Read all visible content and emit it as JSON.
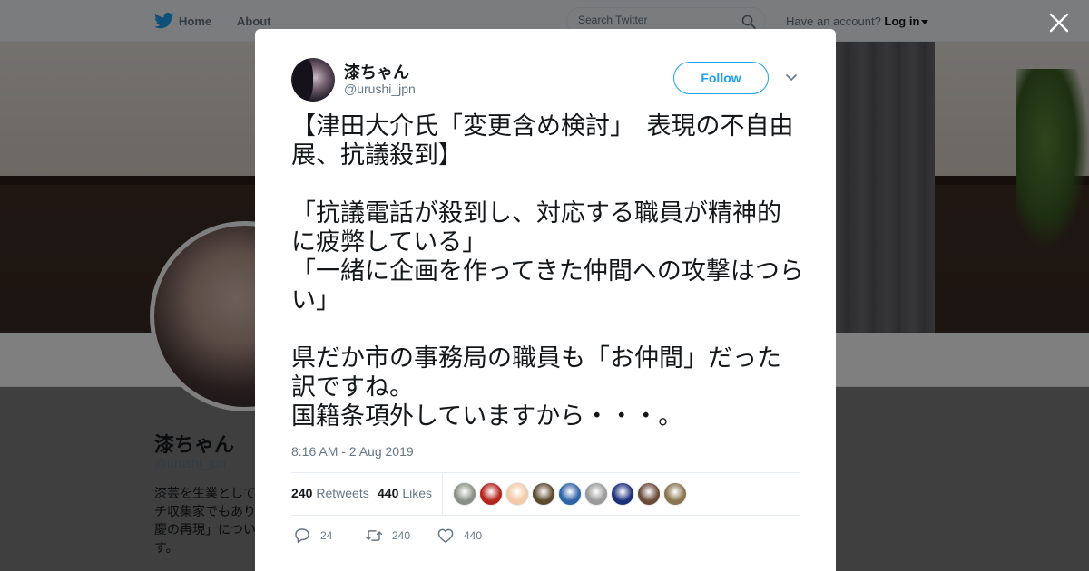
{
  "topbar": {
    "home_label": "Home",
    "about_label": "About",
    "search_placeholder": "Search Twitter",
    "account_prompt": "Have an account?",
    "login_label": "Log in"
  },
  "profile": {
    "name": "漆ちゃん",
    "handle": "@urushi_jpn",
    "bio": "漆芸を生業として\nチ収集家でもあり\n慶の再現」につい\nす。"
  },
  "tweet": {
    "author_name": "漆ちゃん",
    "author_handle": "@urushi_jpn",
    "follow_label": "Follow",
    "text": "【津田大介氏「変更含め検討」　表現の不自由展、抗議殺到】\n\n「抗議電話が殺到し、対応する職員が精神的に疲弊している」\n「一緒に企画を作ってきた仲間への攻撃はつらい」\n\n県だか市の事務局の職員も「お仲間」だった訳ですね。\n国籍条項外していますから・・・。",
    "timestamp": "8:16 AM - 2 Aug 2019",
    "retweets_count": "240",
    "retweets_label": "Retweets",
    "likes_count": "440",
    "likes_label": "Likes",
    "reply_count": "24",
    "retweet_action_count": "240",
    "like_action_count": "440"
  },
  "likers": [
    {
      "color": "#8a8f86"
    },
    {
      "color": "#b2241c"
    },
    {
      "color": "#f3c9a6"
    },
    {
      "color": "#5c4a2e"
    },
    {
      "color": "#2f63a8"
    },
    {
      "color": "#9a9a9a"
    },
    {
      "color": "#1c2f7a"
    },
    {
      "color": "#6b4a3a"
    },
    {
      "color": "#8a7550"
    }
  ],
  "colors": {
    "accent": "#1da1f2",
    "secondary_text": "#657786"
  },
  "icons": {
    "logo": "twitter-bird-icon",
    "search": "search-icon",
    "close": "close-icon",
    "more": "chevron-down-icon",
    "reply": "reply-icon",
    "retweet": "retweet-icon",
    "like": "heart-icon"
  }
}
